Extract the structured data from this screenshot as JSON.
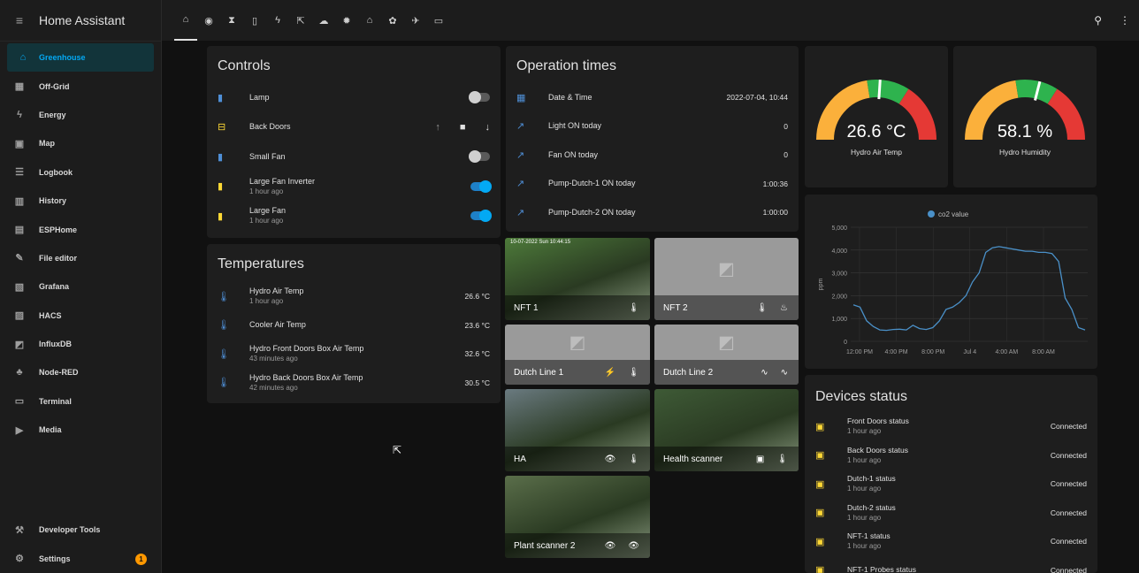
{
  "app_title": "Home Assistant",
  "sidebar": {
    "items": [
      {
        "label": "Greenhouse",
        "icon": "greenhouse-icon",
        "glyph": "⌂",
        "active": true
      },
      {
        "label": "Off-Grid",
        "icon": "dashboard-icon",
        "glyph": "▦"
      },
      {
        "label": "Energy",
        "icon": "lightning-icon",
        "glyph": "ϟ"
      },
      {
        "label": "Map",
        "icon": "map-icon",
        "glyph": "▣"
      },
      {
        "label": "Logbook",
        "icon": "list-icon",
        "glyph": "☰"
      },
      {
        "label": "History",
        "icon": "chart-box-icon",
        "glyph": "▥"
      },
      {
        "label": "ESPHome",
        "icon": "esphome-icon",
        "glyph": "▤"
      },
      {
        "label": "File editor",
        "icon": "wrench-icon",
        "glyph": "✎"
      },
      {
        "label": "Grafana",
        "icon": "grafana-icon",
        "glyph": "▧"
      },
      {
        "label": "HACS",
        "icon": "hacs-icon",
        "glyph": "▨"
      },
      {
        "label": "InfluxDB",
        "icon": "influx-icon",
        "glyph": "◩"
      },
      {
        "label": "Node-RED",
        "icon": "sitemap-icon",
        "glyph": "♣"
      },
      {
        "label": "Terminal",
        "icon": "terminal-icon",
        "glyph": "▭"
      },
      {
        "label": "Media",
        "icon": "media-icon",
        "glyph": "▶"
      }
    ],
    "developer_tools": "Developer Tools",
    "settings": "Settings",
    "settings_badge": "1"
  },
  "topbar": {
    "tabs": [
      {
        "icon": "greenhouse-icon",
        "glyph": "⌂",
        "active": true
      },
      {
        "icon": "cctv-icon",
        "glyph": "◉"
      },
      {
        "icon": "timer-icon",
        "glyph": "⧗"
      },
      {
        "icon": "door-icon",
        "glyph": "▯"
      },
      {
        "icon": "flash-icon",
        "glyph": "ϟ"
      },
      {
        "icon": "fan-arrows-icon",
        "glyph": "⇱"
      },
      {
        "icon": "cloud-icon",
        "glyph": "☁"
      },
      {
        "icon": "sun-icon",
        "glyph": "✹"
      },
      {
        "icon": "home-gear-icon",
        "glyph": "⌂"
      },
      {
        "icon": "sprout-icon",
        "glyph": "✿"
      },
      {
        "icon": "satellite-icon",
        "glyph": "✈"
      },
      {
        "icon": "monitor-icon",
        "glyph": "▭"
      }
    ]
  },
  "controls": {
    "title": "Controls",
    "items": [
      {
        "name": "Lamp",
        "sub": "",
        "color": "#4f8fd6",
        "toggle": "off"
      },
      {
        "name": "Back Doors",
        "sub": "",
        "color": "#fdd835",
        "toggle": "cover"
      },
      {
        "name": "Small Fan",
        "sub": "",
        "color": "#4f8fd6",
        "toggle": "off"
      },
      {
        "name": "Large Fan Inverter",
        "sub": "1 hour ago",
        "color": "#fdd835",
        "toggle": "on"
      },
      {
        "name": "Large Fan",
        "sub": "1 hour ago",
        "color": "#fdd835",
        "toggle": "on"
      }
    ]
  },
  "temperatures": {
    "title": "Temperatures",
    "items": [
      {
        "name": "Hydro Air Temp",
        "sub": "1 hour ago",
        "value": "26.6 °C"
      },
      {
        "name": "Cooler Air Temp",
        "sub": "",
        "value": "23.6 °C"
      },
      {
        "name": "Hydro Front Doors Box Air Temp",
        "sub": "43 minutes ago",
        "value": "32.6 °C"
      },
      {
        "name": "Hydro Back Doors Box Air Temp",
        "sub": "42 minutes ago",
        "value": "30.5 °C"
      }
    ]
  },
  "operation": {
    "title": "Operation times",
    "items": [
      {
        "name": "Date & Time",
        "value": "2022-07-04, 10:44",
        "icon": "calendar-icon",
        "glyph": "▦"
      },
      {
        "name": "Light ON today",
        "value": "0",
        "icon": "chart-line-icon",
        "glyph": "↗"
      },
      {
        "name": "Fan ON today",
        "value": "0",
        "icon": "chart-line-icon",
        "glyph": "↗"
      },
      {
        "name": "Pump-Dutch-1 ON today",
        "value": "1:00:36",
        "icon": "chart-line-icon",
        "glyph": "↗"
      },
      {
        "name": "Pump-Dutch-2 ON today",
        "value": "1:00:00",
        "icon": "chart-line-icon",
        "glyph": "↗"
      }
    ]
  },
  "gauges": [
    {
      "value": "26.6 °C",
      "name": "Hydro Air Temp",
      "level": 0.52
    },
    {
      "value": "58.1 %",
      "name": "Hydro Humidity",
      "level": 0.58
    }
  ],
  "cameras": [
    {
      "label": "NFT 1",
      "kind": "photo",
      "bg": "#4d7a3a",
      "icons": [
        "🌡"
      ],
      "overlay": "10-07-2022 Sun 10:44:15"
    },
    {
      "label": "NFT 2",
      "kind": "placeholder",
      "icons": [
        "🌡",
        "♨"
      ]
    },
    {
      "label": "Dutch Line 1",
      "kind": "placeholder",
      "icons": [
        "⚡",
        "🌡"
      ]
    },
    {
      "label": "Dutch Line 2",
      "kind": "placeholder",
      "icons": [
        "∿",
        "∿"
      ]
    },
    {
      "label": "HA",
      "kind": "photo",
      "bg": "#6a7a80",
      "icons": [
        "👁",
        "🌡"
      ]
    },
    {
      "label": "Health scanner",
      "kind": "photo",
      "bg": "#3e5a36",
      "icons": [
        "▣",
        "🌡"
      ]
    },
    {
      "label": "Plant scanner 2",
      "kind": "photo",
      "bg": "#5a6e4a",
      "icons": [
        "👁",
        "👁"
      ]
    }
  ],
  "chart_data": {
    "type": "line",
    "title": "",
    "series": [
      {
        "name": "co2 value",
        "color": "#4a90c8",
        "values": [
          1600,
          1500,
          900,
          650,
          500,
          480,
          520,
          530,
          500,
          700,
          560,
          520,
          600,
          900,
          1400,
          1500,
          1700,
          2000,
          2600,
          3000,
          3900,
          4100,
          4150,
          4100,
          4050,
          4000,
          3950,
          3950,
          3900,
          3900,
          3850,
          3500,
          1900,
          1400,
          600,
          500
        ]
      }
    ],
    "ylabel": "ppm",
    "ylim": [
      0,
      5000
    ],
    "yticks": [
      "5,000",
      "4,000",
      "3,000",
      "2,000",
      "1,000",
      "0"
    ],
    "xticks": [
      "12:00 PM",
      "4:00 PM",
      "8:00 PM",
      "Jul 4",
      "4:00 AM",
      "8:00 AM"
    ],
    "legend": "top-center"
  },
  "devices": {
    "title": "Devices status",
    "items": [
      {
        "name": "Front Doors status",
        "sub": "1 hour ago",
        "value": "Connected"
      },
      {
        "name": "Back Doors status",
        "sub": "1 hour ago",
        "value": "Connected"
      },
      {
        "name": "Dutch-1 status",
        "sub": "1 hour ago",
        "value": "Connected"
      },
      {
        "name": "Dutch-2 status",
        "sub": "1 hour ago",
        "value": "Connected"
      },
      {
        "name": "NFT-1 status",
        "sub": "1 hour ago",
        "value": "Connected"
      },
      {
        "name": "NFT-1 Probes status",
        "sub": "",
        "value": "Connected"
      }
    ]
  }
}
